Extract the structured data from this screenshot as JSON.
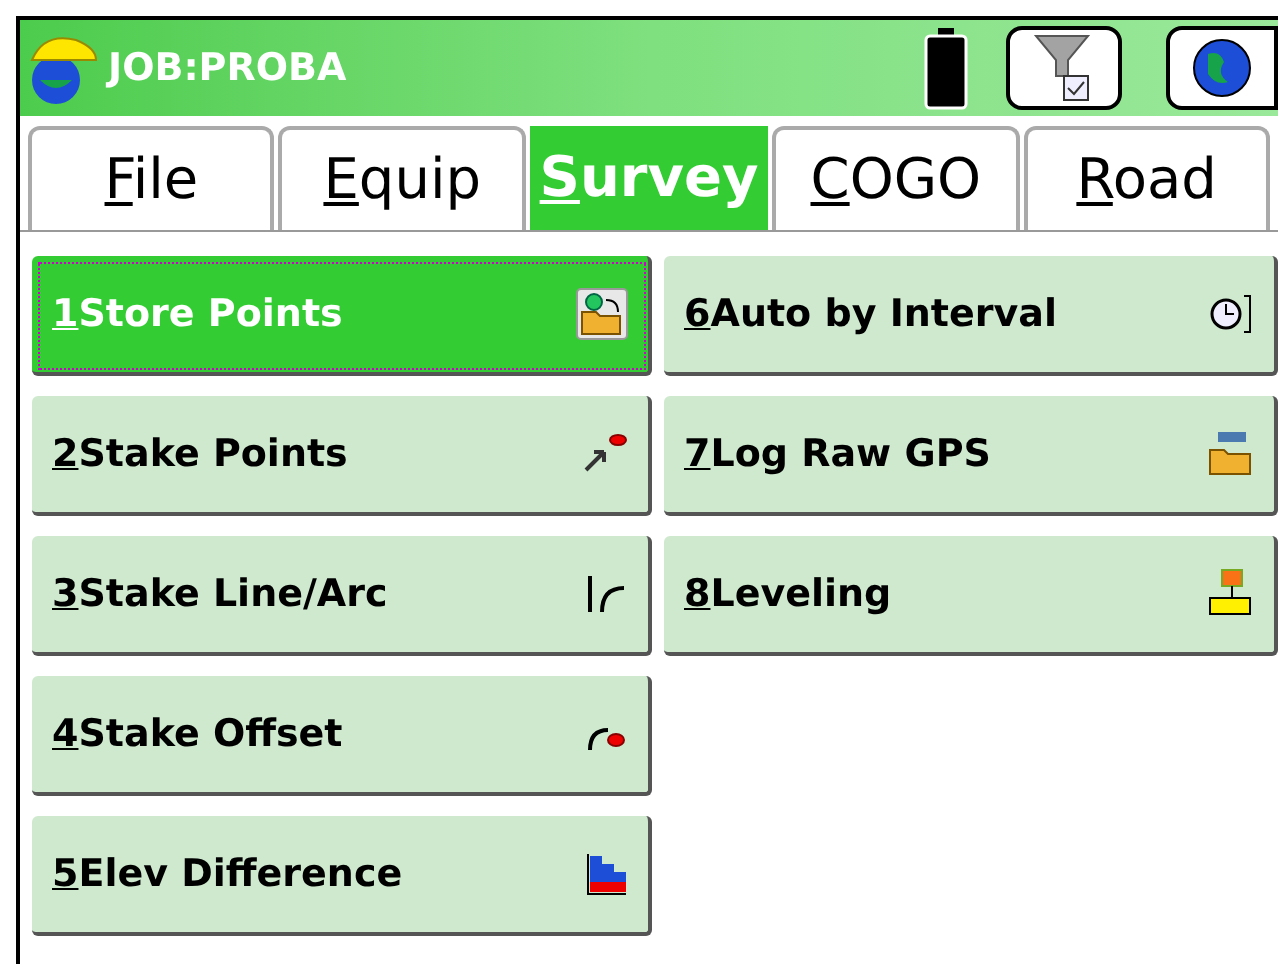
{
  "window": {
    "title": "JOB:PROBA"
  },
  "tabs": [
    {
      "label": "File",
      "selected": false
    },
    {
      "label": "Equip",
      "selected": false
    },
    {
      "label": "Survey",
      "selected": true
    },
    {
      "label": "COGO",
      "selected": false
    },
    {
      "label": "Road",
      "selected": false
    }
  ],
  "left_buttons": [
    {
      "label": "1Store Points",
      "selected": true
    },
    {
      "label": "2Stake Points",
      "selected": false
    },
    {
      "label": "3Stake Line/Arc",
      "selected": false
    },
    {
      "label": "4Stake Offset",
      "selected": false
    },
    {
      "label": "5Elev Difference",
      "selected": false
    }
  ],
  "right_buttons": [
    {
      "label": "6Auto by Interval",
      "selected": false
    },
    {
      "label": "7Log Raw GPS",
      "selected": false
    },
    {
      "label": "8Leveling",
      "selected": false
    }
  ]
}
